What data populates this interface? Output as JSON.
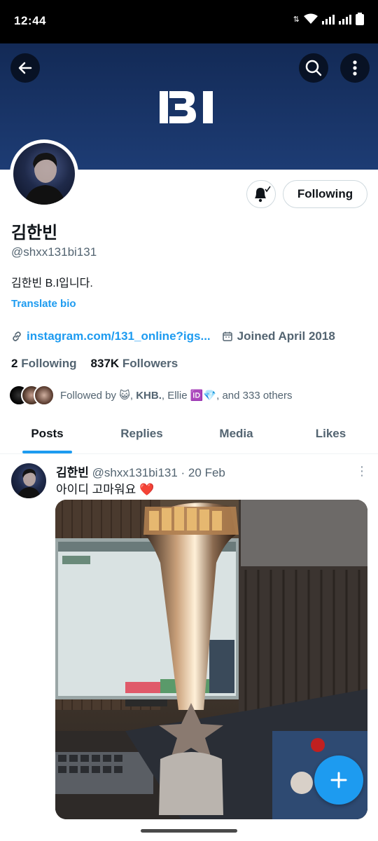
{
  "status": {
    "time": "12:44"
  },
  "header": {
    "banner_logo_text": "B.I",
    "brand_color": "#1d9bf0"
  },
  "profile": {
    "name": "김한빈",
    "handle": "@shxx131bi131",
    "bio": "김한빈 B.I입니다.",
    "translate_label": "Translate bio",
    "link": "instagram.com/131_online?igs...",
    "joined": "Joined April 2018",
    "following_count": "2",
    "following_label": "Following",
    "followers_count": "837K",
    "followers_label": "Followers",
    "follow_button": "Following",
    "followed_by_prefix": "Followed by ",
    "followed_by_emoji1": "😺",
    "followed_by_name1": "KHB.",
    "followed_by_name2": "Ellie",
    "followed_by_emoji2": "🆔💎",
    "followed_by_suffix": ", and 333 others"
  },
  "tabs": [
    {
      "label": "Posts"
    },
    {
      "label": "Replies"
    },
    {
      "label": "Media"
    },
    {
      "label": "Likes"
    }
  ],
  "tweet": {
    "name": "김한빈",
    "handle_time": "@shxx131bi131 · 20 Feb",
    "text": "아이디 고마워요 ",
    "heart": "❤️",
    "more": "⋮"
  }
}
